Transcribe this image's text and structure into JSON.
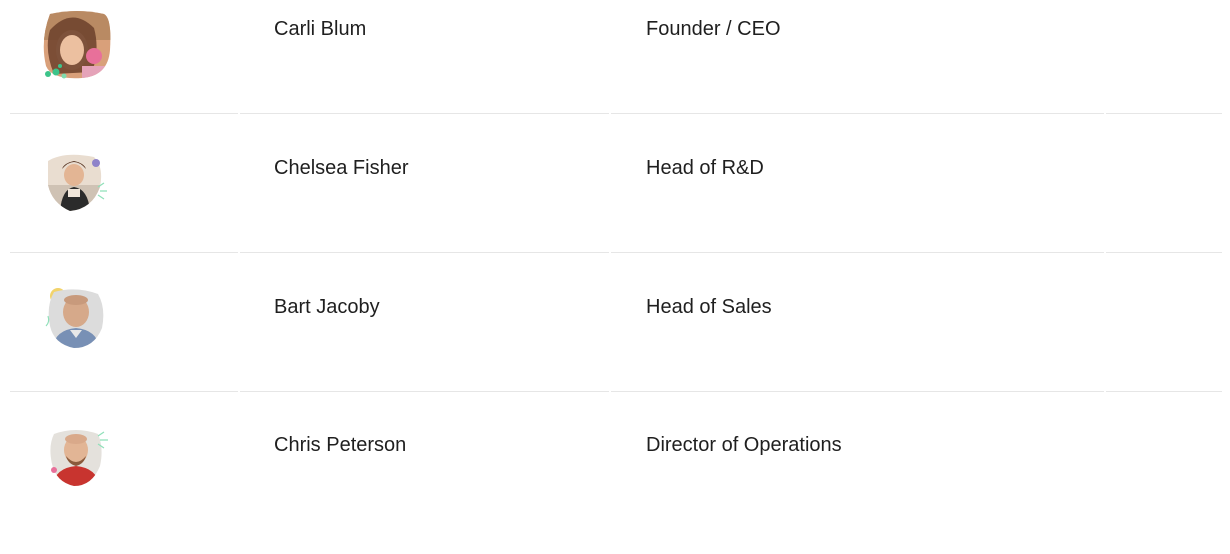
{
  "team": {
    "members": [
      {
        "name": "Carli Blum",
        "role": "Founder / CEO"
      },
      {
        "name": "Chelsea Fisher",
        "role": "Head of R&D"
      },
      {
        "name": "Bart Jacoby",
        "role": "Head of Sales"
      },
      {
        "name": "Chris Peterson",
        "role": "Director of Operations"
      }
    ]
  },
  "colors": {
    "divider": "#e6e6e6",
    "text": "#1f1f1f",
    "accent_green": "#3cc48a",
    "accent_pink": "#e8709a",
    "accent_yellow": "#f2d36b"
  }
}
